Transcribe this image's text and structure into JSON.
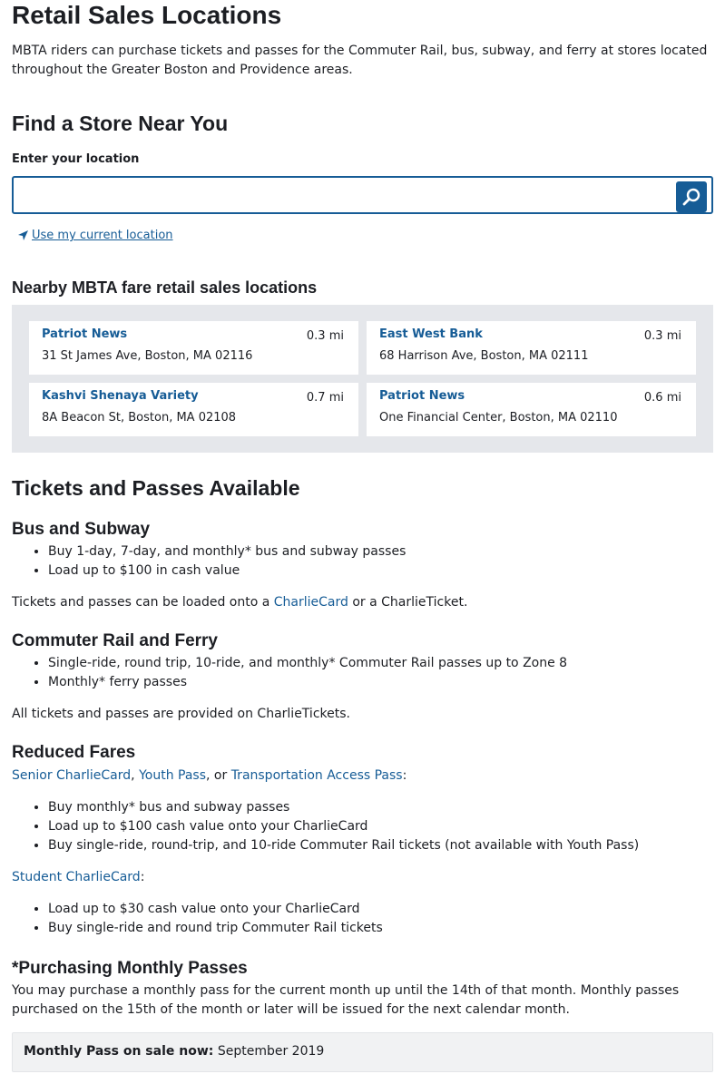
{
  "page": {
    "title": "Retail Sales Locations",
    "intro": "MBTA riders can purchase tickets and passes for the Commuter Rail, bus, subway, and ferry at stores located throughout the Greater Boston and Providence areas."
  },
  "finder": {
    "heading": "Find a Store Near You",
    "input_label": "Enter your location",
    "input_value": "",
    "input_placeholder": "",
    "use_location": "Use my current location"
  },
  "nearby": {
    "heading": "Nearby MBTA fare retail sales locations",
    "stores": [
      {
        "name": "Patriot News",
        "distance": "0.3 mi",
        "address": "31 St James Ave, Boston, MA 02116"
      },
      {
        "name": "East West Bank",
        "distance": "0.3 mi",
        "address": "68 Harrison Ave, Boston, MA 02111"
      },
      {
        "name": "Kashvi Shenaya Variety",
        "distance": "0.7 mi",
        "address": "8A Beacon St, Boston, MA 02108"
      },
      {
        "name": "Patriot News",
        "distance": "0.6 mi",
        "address": "One Financial Center, Boston, MA 02110"
      }
    ]
  },
  "tickets": {
    "heading": "Tickets and Passes Available",
    "bus": {
      "heading": "Bus and Subway",
      "items": [
        "Buy 1-day, 7-day, and monthly* bus and subway passes",
        "Load up to $100 in cash value"
      ],
      "note_pre": "Tickets and passes can be loaded onto a ",
      "note_link": "CharlieCard",
      "note_post": " or a CharlieTicket."
    },
    "rail": {
      "heading": "Commuter Rail and Ferry",
      "items": [
        "Single-ride, round trip, 10-ride, and monthly* Commuter Rail passes up to Zone 8",
        "Monthly* ferry passes"
      ],
      "note": "All tickets and passes are provided on CharlieTickets."
    },
    "reduced": {
      "heading": "Reduced Fares",
      "link1": "Senior CharlieCard",
      "sep1": ", ",
      "link2": "Youth Pass",
      "sep2": ", or ",
      "link3": "Transportation Access Pass",
      "colon": ":",
      "items": [
        "Buy monthly* bus and subway passes",
        "Load up to $100 cash value onto your CharlieCard",
        "Buy single-ride, round-trip, and 10-ride Commuter Rail tickets (not available with Youth Pass)"
      ],
      "student_link": "Student CharlieCard",
      "student_colon": ":",
      "student_items": [
        "Load up to $30 cash value onto your CharlieCard",
        "Buy single-ride and round trip Commuter Rail tickets"
      ]
    },
    "monthly": {
      "heading": "*Purchasing Monthly Passes",
      "text": "You may purchase a monthly pass for the current month up until the 14th of that month. Monthly passes purchased on the 15th of the month or later will be issued for the next calendar month.",
      "sale_label": "Monthly Pass on sale now:",
      "sale_value": " September 2019"
    }
  },
  "colors": {
    "link": "#165c96",
    "panel": "#e5e7eb"
  }
}
